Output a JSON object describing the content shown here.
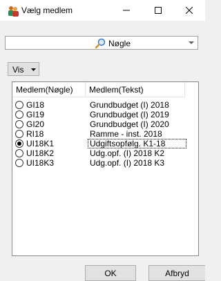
{
  "window": {
    "title": "Vælg medlem",
    "icon": "people-icon",
    "controls": [
      "minimize-icon",
      "maximize-icon",
      "close-icon"
    ]
  },
  "search": {
    "value": "Nøgle",
    "icon": "search-icon"
  },
  "toolbar": {
    "vis_label": "Vis"
  },
  "list": {
    "columns": [
      "Medlem(Nøgle)",
      "Medlem(Tekst)"
    ],
    "rows": [
      {
        "key": "GI18",
        "text": "Grundbudget (I) 2018",
        "selected": false
      },
      {
        "key": "GI19",
        "text": "Grundbudget (I) 2019",
        "selected": false
      },
      {
        "key": "GI20",
        "text": "Grundbudget (I) 2020",
        "selected": false
      },
      {
        "key": "RI18",
        "text": "Ramme - inst. 2018",
        "selected": false
      },
      {
        "key": "UI18K1",
        "text": "Udgiftsopfølg. K1-18",
        "selected": true
      },
      {
        "key": "UI18K2",
        "text": "Udg.opf. (I) 2018 K2",
        "selected": false
      },
      {
        "key": "UI18K3",
        "text": "Udg.opf. (I) 2018 K3",
        "selected": false
      }
    ]
  },
  "buttons": {
    "ok": "OK",
    "cancel": "Afbryd"
  }
}
